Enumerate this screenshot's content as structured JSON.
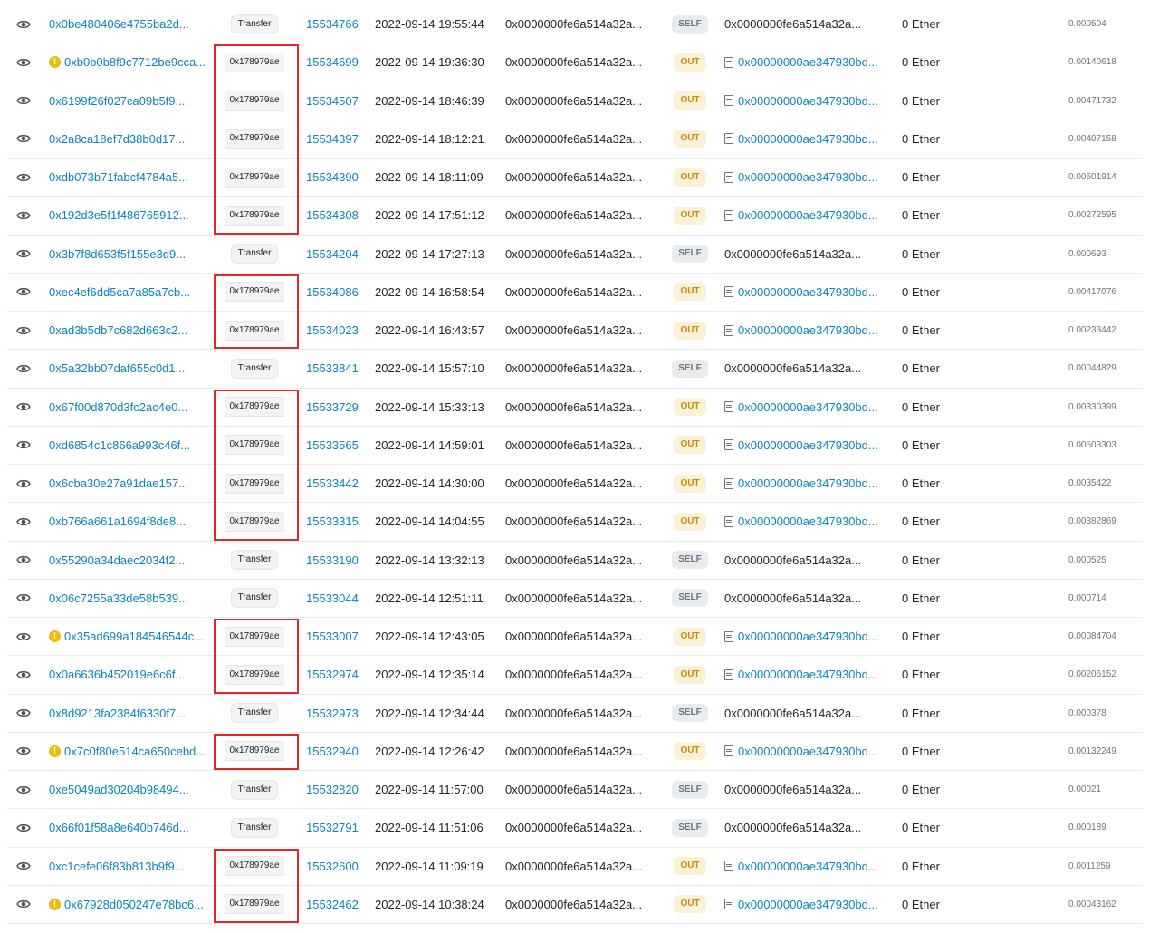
{
  "transactions": [
    {
      "hash": "0x0be480406e4755ba2d...",
      "warning": false,
      "method": "Transfer",
      "highlight": false,
      "block": "15534766",
      "age": "2022-09-14 19:55:44",
      "from": "0x0000000fe6a514a32a...",
      "direction": "SELF",
      "to": "0x0000000fe6a514a32a...",
      "value": "0 Ether",
      "fee": "0.000504"
    },
    {
      "hash": "0xb0b0b8f9c7712be9cca...",
      "warning": true,
      "method": "0x178979ae",
      "highlight": true,
      "block": "15534699",
      "age": "2022-09-14 19:36:30",
      "from": "0x0000000fe6a514a32a...",
      "direction": "OUT",
      "to": "0x00000000ae347930bd...",
      "value": "0 Ether",
      "fee": "0.00140618"
    },
    {
      "hash": "0x6199f26f027ca09b5f9...",
      "warning": false,
      "method": "0x178979ae",
      "highlight": true,
      "block": "15534507",
      "age": "2022-09-14 18:46:39",
      "from": "0x0000000fe6a514a32a...",
      "direction": "OUT",
      "to": "0x00000000ae347930bd...",
      "value": "0 Ether",
      "fee": "0.00471732"
    },
    {
      "hash": "0x2a8ca18ef7d38b0d17...",
      "warning": false,
      "method": "0x178979ae",
      "highlight": true,
      "block": "15534397",
      "age": "2022-09-14 18:12:21",
      "from": "0x0000000fe6a514a32a...",
      "direction": "OUT",
      "to": "0x00000000ae347930bd...",
      "value": "0 Ether",
      "fee": "0.00407158"
    },
    {
      "hash": "0xdb073b71fabcf4784a5...",
      "warning": false,
      "method": "0x178979ae",
      "highlight": true,
      "block": "15534390",
      "age": "2022-09-14 18:11:09",
      "from": "0x0000000fe6a514a32a...",
      "direction": "OUT",
      "to": "0x00000000ae347930bd...",
      "value": "0 Ether",
      "fee": "0.00501914"
    },
    {
      "hash": "0x192d3e5f1f486765912...",
      "warning": false,
      "method": "0x178979ae",
      "highlight": true,
      "block": "15534308",
      "age": "2022-09-14 17:51:12",
      "from": "0x0000000fe6a514a32a...",
      "direction": "OUT",
      "to": "0x00000000ae347930bd...",
      "value": "0 Ether",
      "fee": "0.00272595"
    },
    {
      "hash": "0x3b7f8d653f5f155e3d9...",
      "warning": false,
      "method": "Transfer",
      "highlight": false,
      "block": "15534204",
      "age": "2022-09-14 17:27:13",
      "from": "0x0000000fe6a514a32a...",
      "direction": "SELF",
      "to": "0x0000000fe6a514a32a...",
      "value": "0 Ether",
      "fee": "0.000693"
    },
    {
      "hash": "0xec4ef6dd5ca7a85a7cb...",
      "warning": false,
      "method": "0x178979ae",
      "highlight": true,
      "block": "15534086",
      "age": "2022-09-14 16:58:54",
      "from": "0x0000000fe6a514a32a...",
      "direction": "OUT",
      "to": "0x00000000ae347930bd...",
      "value": "0 Ether",
      "fee": "0.00417076"
    },
    {
      "hash": "0xad3b5db7c682d663c2...",
      "warning": false,
      "method": "0x178979ae",
      "highlight": true,
      "block": "15534023",
      "age": "2022-09-14 16:43:57",
      "from": "0x0000000fe6a514a32a...",
      "direction": "OUT",
      "to": "0x00000000ae347930bd...",
      "value": "0 Ether",
      "fee": "0.00233442"
    },
    {
      "hash": "0x5a32bb07daf655c0d1...",
      "warning": false,
      "method": "Transfer",
      "highlight": false,
      "block": "15533841",
      "age": "2022-09-14 15:57:10",
      "from": "0x0000000fe6a514a32a...",
      "direction": "SELF",
      "to": "0x0000000fe6a514a32a...",
      "value": "0 Ether",
      "fee": "0.00044829"
    },
    {
      "hash": "0x67f00d870d3fc2ac4e0...",
      "warning": false,
      "method": "0x178979ae",
      "highlight": true,
      "block": "15533729",
      "age": "2022-09-14 15:33:13",
      "from": "0x0000000fe6a514a32a...",
      "direction": "OUT",
      "to": "0x00000000ae347930bd...",
      "value": "0 Ether",
      "fee": "0.00330399"
    },
    {
      "hash": "0xd6854c1c866a993c46f...",
      "warning": false,
      "method": "0x178979ae",
      "highlight": true,
      "block": "15533565",
      "age": "2022-09-14 14:59:01",
      "from": "0x0000000fe6a514a32a...",
      "direction": "OUT",
      "to": "0x00000000ae347930bd...",
      "value": "0 Ether",
      "fee": "0.00503303"
    },
    {
      "hash": "0x6cba30e27a91dae157...",
      "warning": false,
      "method": "0x178979ae",
      "highlight": true,
      "block": "15533442",
      "age": "2022-09-14 14:30:00",
      "from": "0x0000000fe6a514a32a...",
      "direction": "OUT",
      "to": "0x00000000ae347930bd...",
      "value": "0 Ether",
      "fee": "0.0035422"
    },
    {
      "hash": "0xb766a661a1694f8de8...",
      "warning": false,
      "method": "0x178979ae",
      "highlight": true,
      "block": "15533315",
      "age": "2022-09-14 14:04:55",
      "from": "0x0000000fe6a514a32a...",
      "direction": "OUT",
      "to": "0x00000000ae347930bd...",
      "value": "0 Ether",
      "fee": "0.00382869"
    },
    {
      "hash": "0x55290a34daec2034f2...",
      "warning": false,
      "method": "Transfer",
      "highlight": false,
      "block": "15533190",
      "age": "2022-09-14 13:32:13",
      "from": "0x0000000fe6a514a32a...",
      "direction": "SELF",
      "to": "0x0000000fe6a514a32a...",
      "value": "0 Ether",
      "fee": "0.000525"
    },
    {
      "hash": "0x06c7255a33de58b539...",
      "warning": false,
      "method": "Transfer",
      "highlight": false,
      "block": "15533044",
      "age": "2022-09-14 12:51:11",
      "from": "0x0000000fe6a514a32a...",
      "direction": "SELF",
      "to": "0x0000000fe6a514a32a...",
      "value": "0 Ether",
      "fee": "0.000714"
    },
    {
      "hash": "0x35ad699a184546544c...",
      "warning": true,
      "method": "0x178979ae",
      "highlight": true,
      "block": "15533007",
      "age": "2022-09-14 12:43:05",
      "from": "0x0000000fe6a514a32a...",
      "direction": "OUT",
      "to": "0x00000000ae347930bd...",
      "value": "0 Ether",
      "fee": "0.00084704"
    },
    {
      "hash": "0x0a6636b452019e6c6f...",
      "warning": false,
      "method": "0x178979ae",
      "highlight": true,
      "block": "15532974",
      "age": "2022-09-14 12:35:14",
      "from": "0x0000000fe6a514a32a...",
      "direction": "OUT",
      "to": "0x00000000ae347930bd...",
      "value": "0 Ether",
      "fee": "0.00206152"
    },
    {
      "hash": "0x8d9213fa2384f6330f7...",
      "warning": false,
      "method": "Transfer",
      "highlight": false,
      "block": "15532973",
      "age": "2022-09-14 12:34:44",
      "from": "0x0000000fe6a514a32a...",
      "direction": "SELF",
      "to": "0x0000000fe6a514a32a...",
      "value": "0 Ether",
      "fee": "0.000378"
    },
    {
      "hash": "0x7c0f80e514ca650cebd...",
      "warning": true,
      "method": "0x178979ae",
      "highlight": true,
      "block": "15532940",
      "age": "2022-09-14 12:26:42",
      "from": "0x0000000fe6a514a32a...",
      "direction": "OUT",
      "to": "0x00000000ae347930bd...",
      "value": "0 Ether",
      "fee": "0.00132249"
    },
    {
      "hash": "0xe5049ad30204b98494...",
      "warning": false,
      "method": "Transfer",
      "highlight": false,
      "block": "15532820",
      "age": "2022-09-14 11:57:00",
      "from": "0x0000000fe6a514a32a...",
      "direction": "SELF",
      "to": "0x0000000fe6a514a32a...",
      "value": "0 Ether",
      "fee": "0.00021"
    },
    {
      "hash": "0x66f01f58a8e640b746d...",
      "warning": false,
      "method": "Transfer",
      "highlight": false,
      "block": "15532791",
      "age": "2022-09-14 11:51:06",
      "from": "0x0000000fe6a514a32a...",
      "direction": "SELF",
      "to": "0x0000000fe6a514a32a...",
      "value": "0 Ether",
      "fee": "0.000189"
    },
    {
      "hash": "0xc1cefe06f83b813b9f9...",
      "warning": false,
      "method": "0x178979ae",
      "highlight": true,
      "block": "15532600",
      "age": "2022-09-14 11:09:19",
      "from": "0x0000000fe6a514a32a...",
      "direction": "OUT",
      "to": "0x00000000ae347930bd...",
      "value": "0 Ether",
      "fee": "0.0011259"
    },
    {
      "hash": "0x67928d050247e78bc6...",
      "warning": true,
      "method": "0x178979ae",
      "highlight": true,
      "block": "15532462",
      "age": "2022-09-14 10:38:24",
      "from": "0x0000000fe6a514a32a...",
      "direction": "OUT",
      "to": "0x00000000ae347930bd...",
      "value": "0 Ether",
      "fee": "0.00043162"
    }
  ],
  "icons": {
    "view": "eye-icon",
    "warning": "exclamation-circle-icon",
    "contract": "document-icon"
  },
  "colors": {
    "link": "#0784c3",
    "highlight_border": "#e32626",
    "out_badge_bg": "#fcf1d6",
    "out_badge_text": "#c98a0a",
    "self_badge_bg": "#e9ecef",
    "warning": "#f0b90b"
  }
}
